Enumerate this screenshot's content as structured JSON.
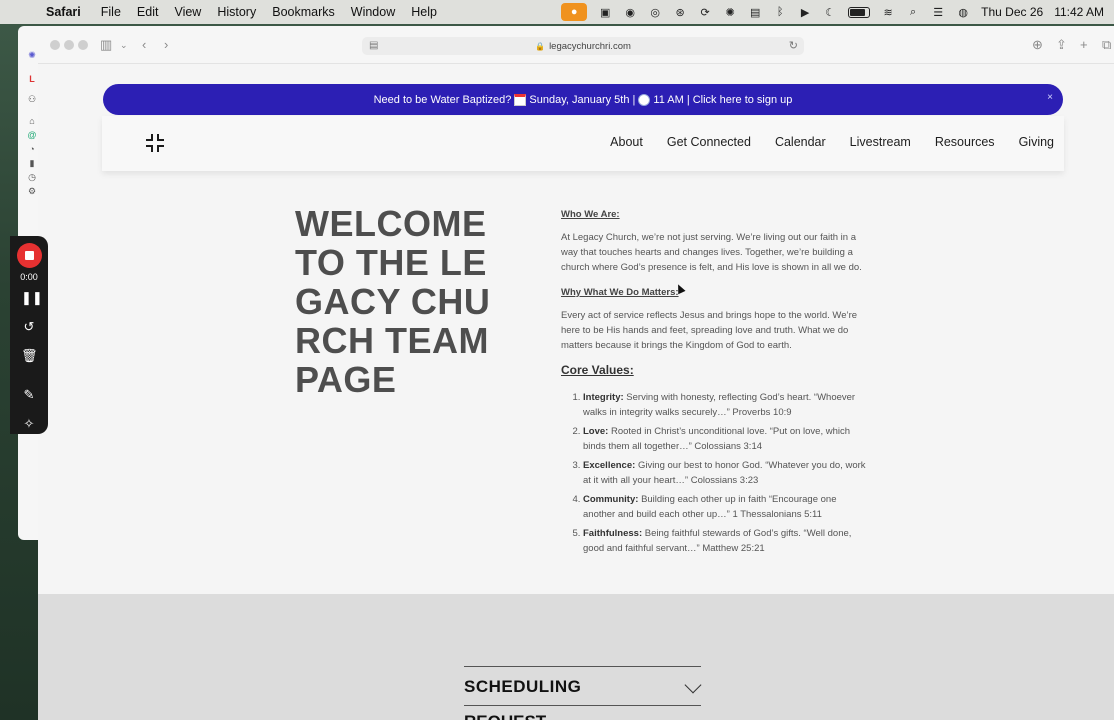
{
  "menubar": {
    "app_name": "Safari",
    "items": [
      "File",
      "Edit",
      "View",
      "History",
      "Bookmarks",
      "Window",
      "Help"
    ],
    "date": "Thu Dec 26",
    "time": "11:42 AM"
  },
  "browser": {
    "url": "legacychurchri.com"
  },
  "recorder": {
    "time": "0:00"
  },
  "banner": {
    "text_part1": "Need to be Water Baptized?",
    "text_part2": "Sunday, January 5th |",
    "text_part3": "11 AM | Click here to sign up",
    "close": "×"
  },
  "nav": {
    "links": [
      "About",
      "Get Connected",
      "Calendar",
      "Livestream",
      "Resources",
      "Giving"
    ]
  },
  "hero": {
    "title": "WELCOME TO THE LEGACY CHURCH TEAM PAGE"
  },
  "content": {
    "who_heading": "Who We Are:",
    "who_text": "At Legacy Church, we’re not just serving. We’re living out our faith in a way that touches hearts and changes lives. Together, we’re building a church where God’s presence is felt, and His love is shown in all we do.",
    "why_heading": "Why What We Do Matters:",
    "why_text": "Every act of service reflects Jesus and brings hope to the world. We’re here to be His hands and feet, spreading love and truth. What we do matters because it brings the Kingdom of God to earth.",
    "core_heading": "Core Values:",
    "values": [
      {
        "name": "Integrity:",
        "text": "Serving with honesty, reflecting God’s heart. “Whoever walks in integrity walks securely…” Proverbs 10:9"
      },
      {
        "name": "Love:",
        "text": "Rooted in Christ’s unconditional love. “Put on love, which binds them all together…” Colossians 3:14"
      },
      {
        "name": "Excellence:",
        "text": "Giving our best to honor God. “Whatever you do, work at it with all your heart…” Colossians 3:23"
      },
      {
        "name": "Community:",
        "text": "Building each other up in faith “Encourage one another and build each other up…” 1 Thessalonians 5:11"
      },
      {
        "name": "Faithfulness:",
        "text": "Being faithful stewards of God’s gifts. “Well done, good and faithful servant…” Matthew 25:21"
      }
    ]
  },
  "accordion": {
    "scheduling": "SCHEDULING",
    "next_partial": "REQUEST"
  }
}
